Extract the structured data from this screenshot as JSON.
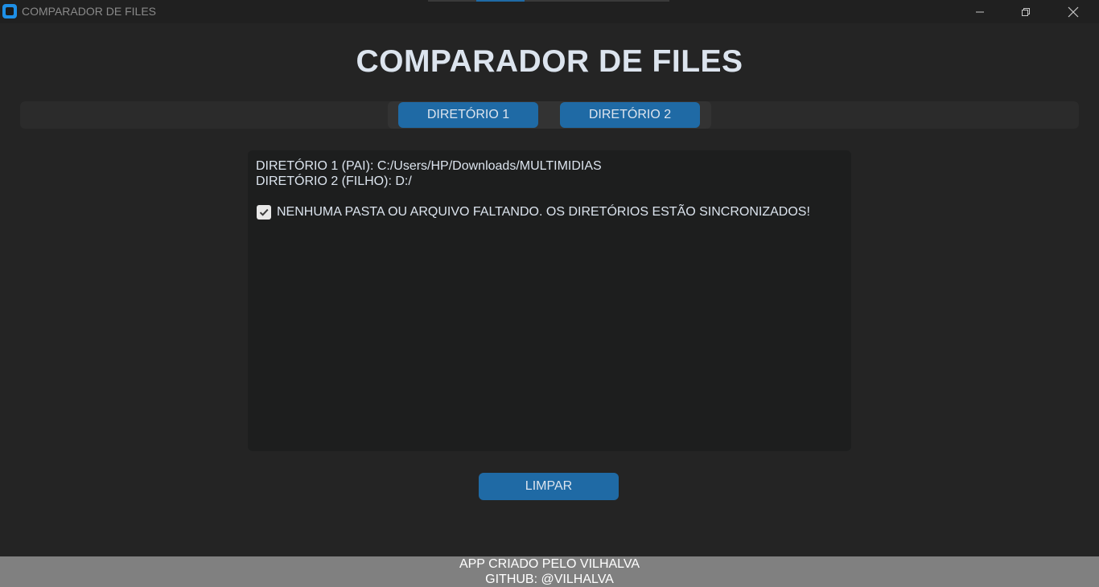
{
  "window": {
    "title": "COMPARADOR DE FILES",
    "controls": [
      "minimize-icon",
      "restore-icon",
      "close-icon"
    ]
  },
  "header": {
    "title": "COMPARADOR DE FILES"
  },
  "tabs": [
    {
      "label": "DIRETÓRIO 1"
    },
    {
      "label": "DIRETÓRIO 2"
    }
  ],
  "output": {
    "line1": "DIRETÓRIO 1 (PAI): C:/Users/HP/Downloads/MULTIMIDIAS",
    "line2": "DIRETÓRIO 2 (FILHO): D:/",
    "status_icon": "checkmark-icon",
    "status_text": "NENHUMA PASTA OU ARQUIVO FALTANDO. OS DIRETÓRIOS ESTÃO SINCRONIZADOS!"
  },
  "actions": {
    "clear_label": "LIMPAR"
  },
  "footer": {
    "line1": "APP CRIADO PELO VILHALVA",
    "line2": "GITHUB: @VILHALVA"
  },
  "colors": {
    "background": "#242424",
    "accent": "#1f6aa5",
    "text": "#dce4ee",
    "textbox": "#1d1e1e",
    "footer": "#808080"
  }
}
